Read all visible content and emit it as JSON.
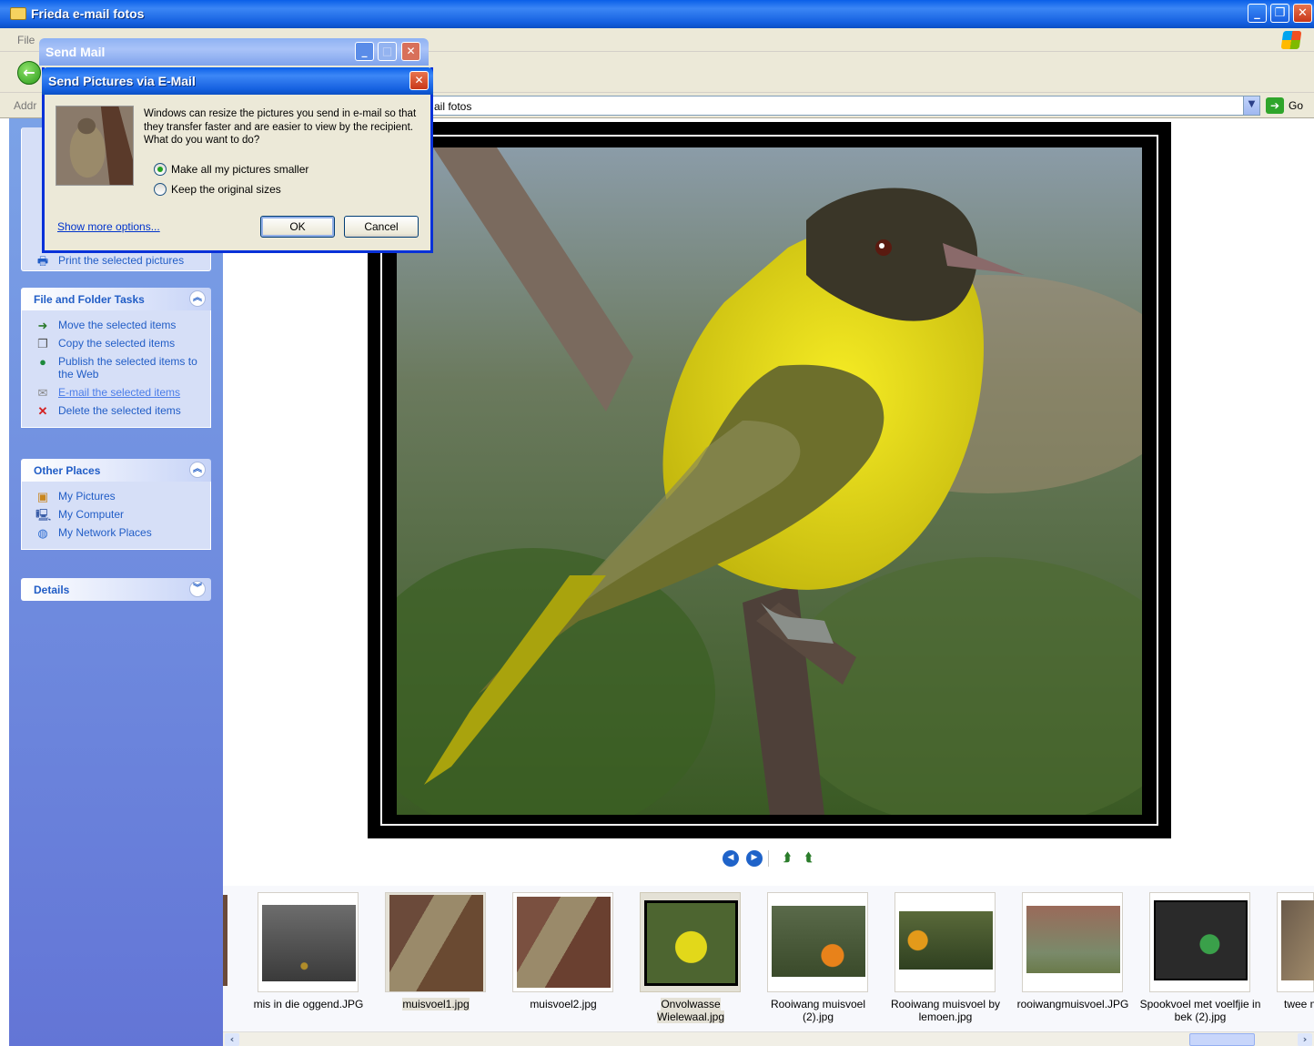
{
  "window": {
    "title": "Frieda e-mail fotos"
  },
  "menubar": {
    "first_item": "File"
  },
  "address": {
    "label": "Addr",
    "value": "ail fotos",
    "go_label": "Go"
  },
  "sendmail": {
    "title": "Send Mail"
  },
  "dialog": {
    "title": "Send Pictures via E-Mail",
    "message": "Windows can resize the pictures you send in e-mail so that they transfer faster and are easier to view by the recipient.  What do you want to do?",
    "options": [
      "Make all my pictures smaller",
      "Keep the original sizes"
    ],
    "selected_option": 0,
    "more_link": "Show more options...",
    "ok": "OK",
    "cancel": "Cancel"
  },
  "taskpane": {
    "hidden_task": "Print the selected pictures",
    "file_folder": {
      "title": "File and Folder Tasks",
      "items": [
        {
          "label": "Move the selected items",
          "icon": "move-icon"
        },
        {
          "label": "Copy the selected items",
          "icon": "copy-icon"
        },
        {
          "label": "Publish the selected items to the Web",
          "icon": "globe-icon"
        },
        {
          "label": "E-mail the selected items",
          "icon": "email-icon"
        },
        {
          "label": "Delete the selected items",
          "icon": "delete-icon"
        }
      ]
    },
    "other_places": {
      "title": "Other Places",
      "items": [
        {
          "label": "My Pictures",
          "icon": "my-pictures-icon"
        },
        {
          "label": "My Computer",
          "icon": "my-computer-icon"
        },
        {
          "label": "My Network Places",
          "icon": "network-icon"
        }
      ]
    },
    "details": {
      "title": "Details"
    }
  },
  "filmstrip": {
    "thumbnails": [
      {
        "caption": "mis in die oggend.JPG"
      },
      {
        "caption": "muisvoel1.jpg"
      },
      {
        "caption": "muisvoel2.jpg"
      },
      {
        "caption": "Onvolwasse Wielewaal.jpg"
      },
      {
        "caption": "Rooiwang muisvoel (2).jpg"
      },
      {
        "caption": "Rooiwang muisvoel by lemoen.jpg"
      },
      {
        "caption": "rooiwangmuisvoel.JPG"
      },
      {
        "caption": "Spookvoel met voelfjie in bek (2).jpg"
      },
      {
        "caption": "twee mui"
      }
    ],
    "selected": 3
  }
}
